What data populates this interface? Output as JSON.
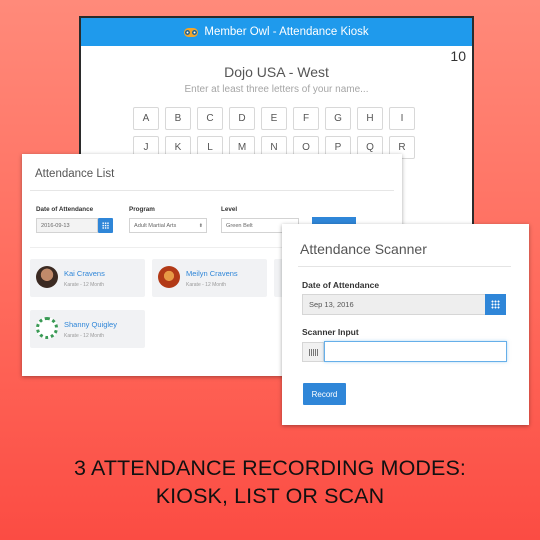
{
  "kiosk": {
    "app_title": "Member Owl - Attendance Kiosk",
    "count": "10",
    "location": "Dojo USA - West",
    "prompt": "Enter at least three letters of your name...",
    "letters_row1": [
      "A",
      "B",
      "C",
      "D",
      "E",
      "F",
      "G",
      "H",
      "I"
    ],
    "letters_row2": [
      "J",
      "K",
      "L",
      "M",
      "N",
      "O",
      "P",
      "Q",
      "R"
    ],
    "icon": "owl-logo-icon"
  },
  "attendance_list": {
    "title": "Attendance List",
    "date_label": "Date of Attendance",
    "date_value": "2016-09-13",
    "program_label": "Program",
    "program_value": "Adult Martial Arts",
    "level_label": "Level",
    "level_value": "Green Belt",
    "members": [
      {
        "name": "Kai Cravens",
        "meta": "Karate - 12 Month"
      },
      {
        "name": "Meilyn Cravens",
        "meta": "Karate - 12 Month"
      },
      {
        "name": "Shanny Quigley",
        "meta": "Karate - 12 Month"
      }
    ]
  },
  "scanner": {
    "title": "Attendance Scanner",
    "date_label": "Date of Attendance",
    "date_value": "Sep 13, 2016",
    "input_label": "Scanner Input",
    "input_value": "",
    "record_label": "Record",
    "icons": [
      "calendar-icon",
      "barcode-icon"
    ]
  },
  "caption": {
    "line1": "3 ATTENDANCE RECORDING MODES:",
    "line2": "KIOSK, LIST OR SCAN"
  },
  "colors": {
    "accent": "#2f86d8",
    "kiosk_bar": "#1f9aec",
    "background": "#ff6a5c"
  }
}
